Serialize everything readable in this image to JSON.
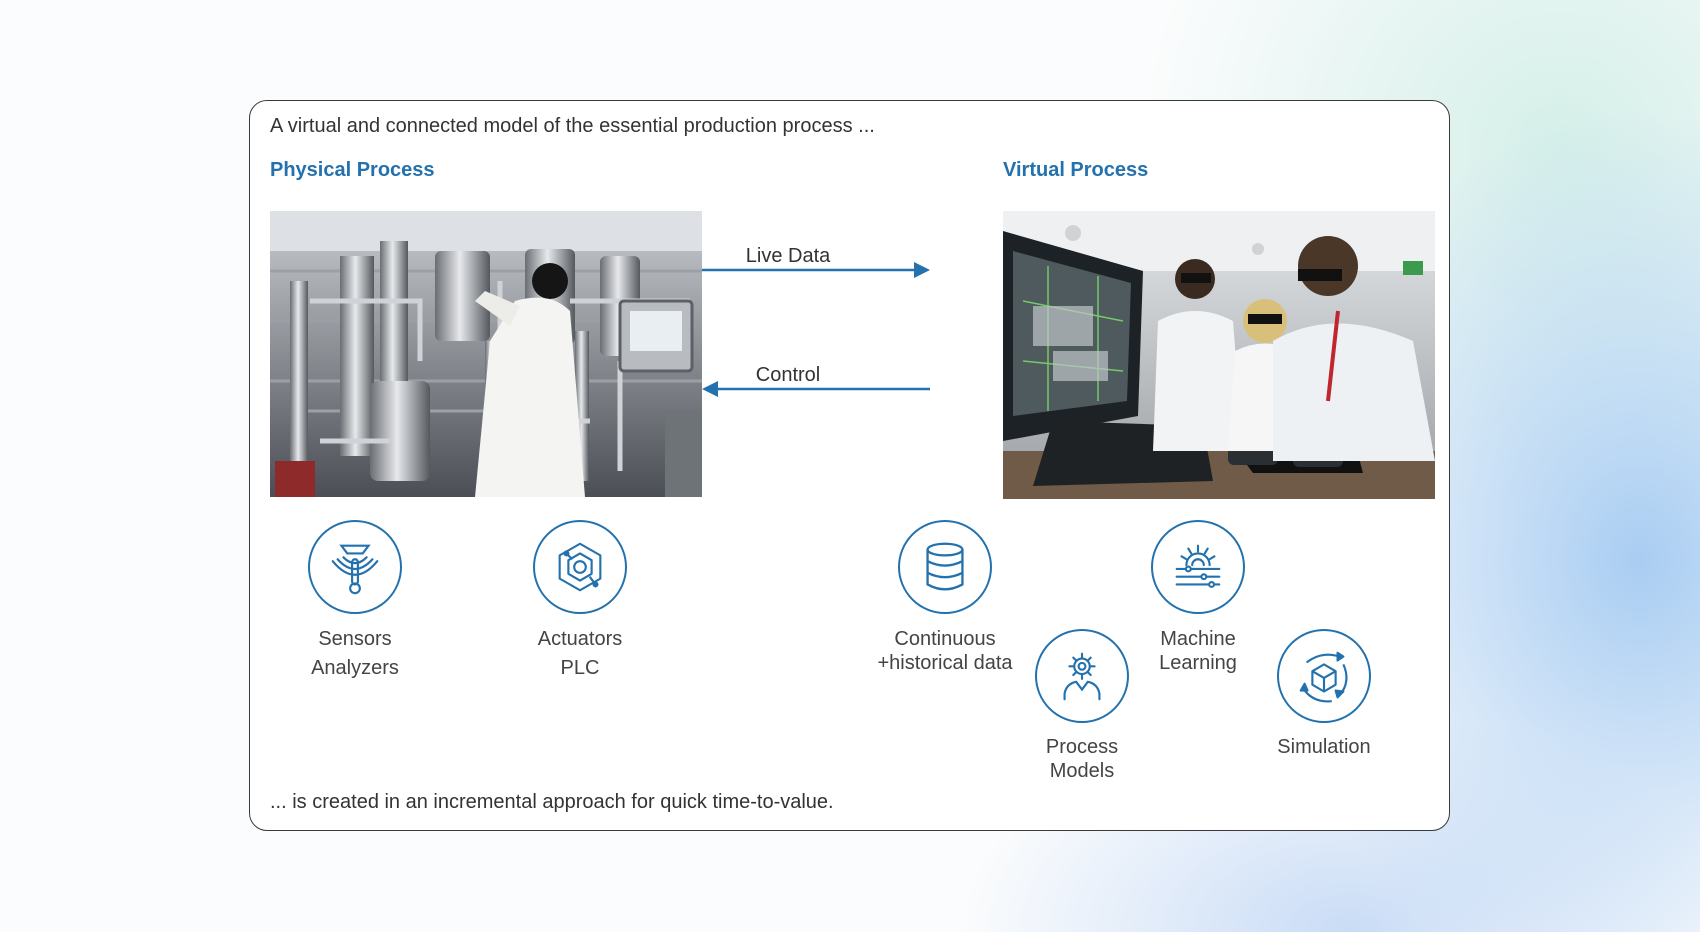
{
  "intro": "A virtual and connected model of the essential production process ...",
  "outro": "... is created in an incremental approach for quick time-to-value.",
  "physical": {
    "title": "Physical Process",
    "photo": "lab-equipment-photo"
  },
  "virtual": {
    "title": "Virtual Process",
    "photo": "3d-glasses-team-photo"
  },
  "arrows": {
    "live_data": "Live Data",
    "control": "Control"
  },
  "icons": {
    "sensors": {
      "line1": "Sensors",
      "line2": "Analyzers",
      "icon": "sensor-thermometer-icon"
    },
    "actuators": {
      "line1": "Actuators",
      "line2": "PLC",
      "icon": "hexagon-circuit-icon"
    },
    "data": {
      "line1": "Continuous",
      "line2": "+historical data",
      "icon": "database-icon"
    },
    "ml": {
      "line1": "Machine",
      "line2": "Learning",
      "icon": "gear-sliders-icon"
    },
    "models": {
      "line1": "Process",
      "line2": "Models",
      "icon": "gear-person-icon"
    },
    "simulation": {
      "line1": "Simulation",
      "icon": "cube-orbit-icon"
    }
  },
  "colors": {
    "accent": "#2371ad",
    "text": "#333333",
    "border": "#3a3a3a"
  }
}
